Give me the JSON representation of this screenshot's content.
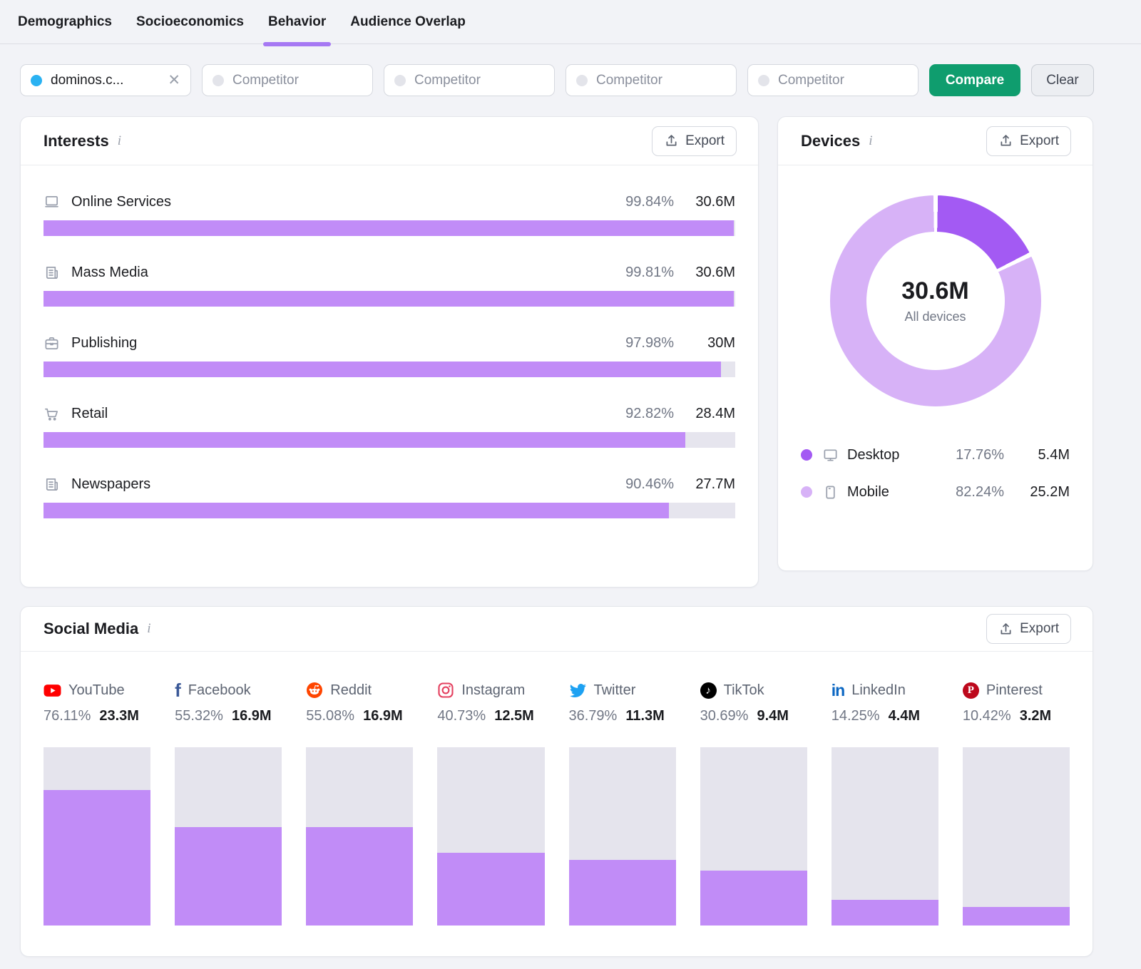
{
  "tabs": [
    {
      "label": "Demographics",
      "active": false
    },
    {
      "label": "Socioeconomics",
      "active": false
    },
    {
      "label": "Behavior",
      "active": true
    },
    {
      "label": "Audience Overlap",
      "active": false
    }
  ],
  "filters": {
    "domain_chip": {
      "label": "dominos.c...",
      "dot_color": "#2ab2f2"
    },
    "competitor_placeholder": "Competitor",
    "compare_label": "Compare",
    "clear_label": "Clear"
  },
  "interests": {
    "title": "Interests",
    "export_label": "Export",
    "rows": [
      {
        "icon": "monitor-icon",
        "label": "Online Services",
        "percent": "99.84%",
        "percent_num": 99.84,
        "value": "30.6M"
      },
      {
        "icon": "news-icon",
        "label": "Mass Media",
        "percent": "99.81%",
        "percent_num": 99.81,
        "value": "30.6M"
      },
      {
        "icon": "briefcase-icon",
        "label": "Publishing",
        "percent": "97.98%",
        "percent_num": 97.98,
        "value": "30M"
      },
      {
        "icon": "cart-icon",
        "label": "Retail",
        "percent": "92.82%",
        "percent_num": 92.82,
        "value": "28.4M"
      },
      {
        "icon": "news-icon",
        "label": "Newspapers",
        "percent": "90.46%",
        "percent_num": 90.46,
        "value": "27.7M"
      }
    ]
  },
  "devices": {
    "title": "Devices",
    "export_label": "Export",
    "total": "30.6M",
    "total_caption": "All devices",
    "segments": [
      {
        "label": "Desktop",
        "percent": "17.76%",
        "percent_num": 17.76,
        "value": "5.4M",
        "color": "#a35af3"
      },
      {
        "label": "Mobile",
        "percent": "82.24%",
        "percent_num": 82.24,
        "value": "25.2M",
        "color": "#d7b2f7"
      }
    ]
  },
  "social": {
    "title": "Social Media",
    "export_label": "Export",
    "platforms": [
      {
        "name": "YouTube",
        "percent": "76.11%",
        "percent_num": 76.11,
        "value": "23.3M",
        "brand_color": "#ff0000"
      },
      {
        "name": "Facebook",
        "percent": "55.32%",
        "percent_num": 55.32,
        "value": "16.9M",
        "brand_color": "#3b5998"
      },
      {
        "name": "Reddit",
        "percent": "55.08%",
        "percent_num": 55.08,
        "value": "16.9M",
        "brand_color": "#ff4500"
      },
      {
        "name": "Instagram",
        "percent": "40.73%",
        "percent_num": 40.73,
        "value": "12.5M",
        "brand_color": "#e4405f"
      },
      {
        "name": "Twitter",
        "percent": "36.79%",
        "percent_num": 36.79,
        "value": "11.3M",
        "brand_color": "#1da1f2"
      },
      {
        "name": "TikTok",
        "percent": "30.69%",
        "percent_num": 30.69,
        "value": "9.4M",
        "brand_color": "#000000"
      },
      {
        "name": "LinkedIn",
        "percent": "14.25%",
        "percent_num": 14.25,
        "value": "4.4M",
        "brand_color": "#0a66c2"
      },
      {
        "name": "Pinterest",
        "percent": "10.42%",
        "percent_num": 10.42,
        "value": "3.2M",
        "brand_color": "#bd081c"
      }
    ]
  },
  "colors": {
    "accent_purple": "#a678f3",
    "bar_purple": "#c18cf7",
    "bar_track": "#e5e4ed",
    "compare_green": "#0f9d6e",
    "text_gray": "#717785",
    "page_bg": "#f2f3f7"
  },
  "chart_data": [
    {
      "type": "bar",
      "title": "Interests",
      "orientation": "horizontal",
      "categories": [
        "Online Services",
        "Mass Media",
        "Publishing",
        "Retail",
        "Newspapers"
      ],
      "values": [
        99.84,
        99.81,
        97.98,
        92.82,
        90.46
      ],
      "value_labels": [
        "30.6M",
        "30.6M",
        "30M",
        "28.4M",
        "27.7M"
      ],
      "xlim": [
        0,
        100
      ],
      "ylabel": "",
      "xlabel": "",
      "grid": false
    },
    {
      "type": "pie",
      "title": "Devices",
      "center_label": "30.6M",
      "center_caption": "All devices",
      "categories": [
        "Desktop",
        "Mobile"
      ],
      "values": [
        17.76,
        82.24
      ],
      "value_labels": [
        "5.4M",
        "25.2M"
      ],
      "legend_position": "bottom"
    },
    {
      "type": "bar",
      "title": "Social Media",
      "orientation": "vertical",
      "categories": [
        "YouTube",
        "Facebook",
        "Reddit",
        "Instagram",
        "Twitter",
        "TikTok",
        "LinkedIn",
        "Pinterest"
      ],
      "values": [
        76.11,
        55.32,
        55.08,
        40.73,
        36.79,
        30.69,
        14.25,
        10.42
      ],
      "value_labels": [
        "23.3M",
        "16.9M",
        "16.9M",
        "12.5M",
        "11.3M",
        "9.4M",
        "4.4M",
        "3.2M"
      ],
      "ylim": [
        0,
        100
      ],
      "grid": false
    }
  ]
}
